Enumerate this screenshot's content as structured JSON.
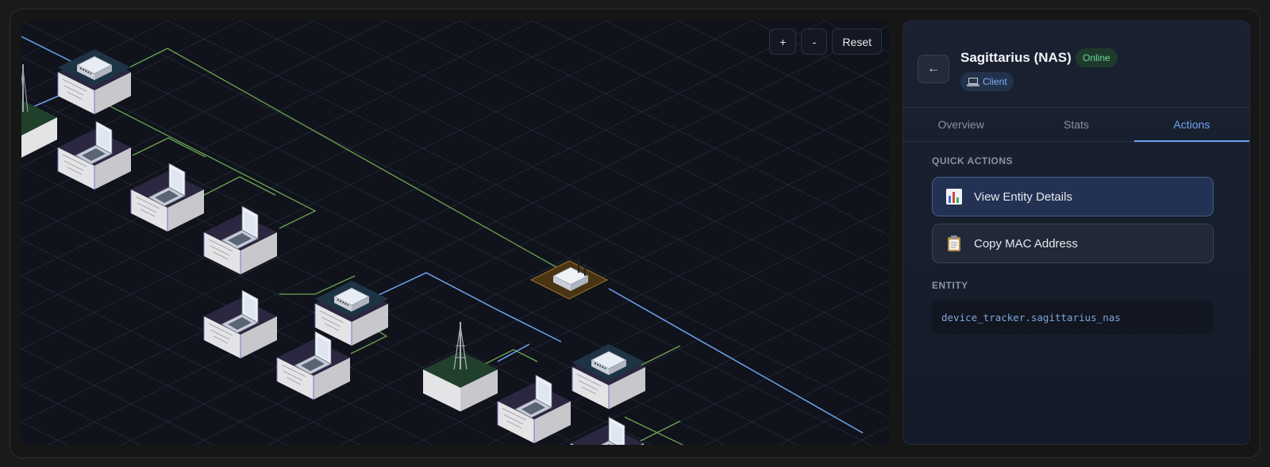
{
  "map": {
    "controls": {
      "zoom_in": "+",
      "zoom_out": "-",
      "reset": "Reset"
    }
  },
  "panel": {
    "back_icon": "arrow-left-icon",
    "title": "Sagittarius (NAS)",
    "status": "Online",
    "type_badge": "Client",
    "tabs": [
      "Overview",
      "Stats",
      "Actions"
    ],
    "active_tab": "Actions",
    "quick_actions_label": "QUICK ACTIONS",
    "actions": [
      {
        "label": "View Entity Details",
        "icon": "bar-chart-icon"
      },
      {
        "label": "Copy MAC Address",
        "icon": "clipboard-icon"
      }
    ],
    "entity_label": "ENTITY",
    "entity_id": "device_tracker.sagittarius_nas"
  },
  "colors": {
    "accent": "#6fa5f3",
    "online": "#6fd897",
    "wired_link": "#6fa5f3",
    "wireless_link": "#7fbf5a"
  }
}
